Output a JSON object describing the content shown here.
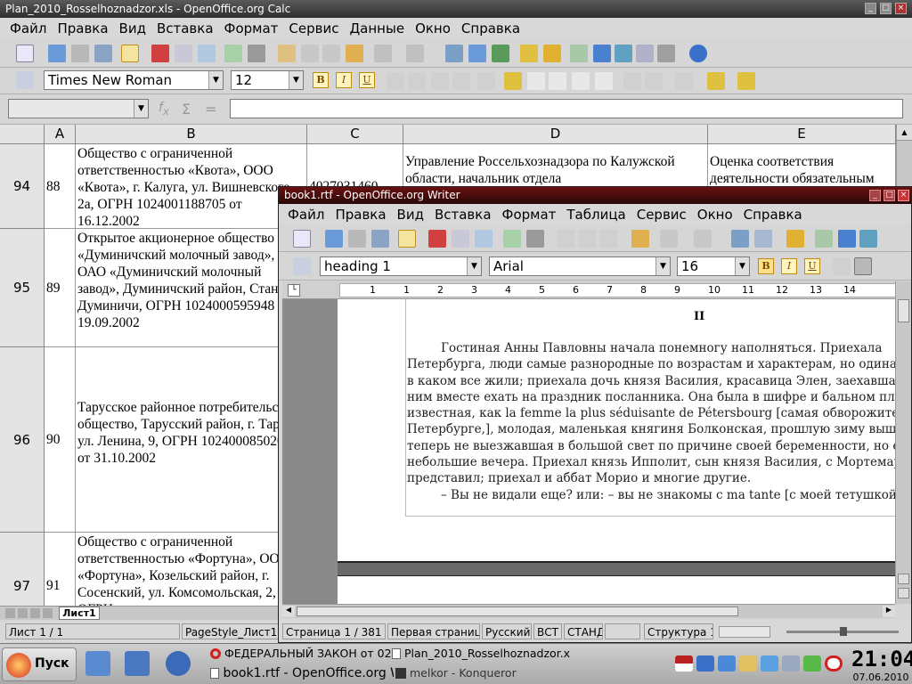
{
  "calc": {
    "title": "Plan_2010_Rosselhoznadzor.xls - OpenOffice.org Calc",
    "menu": [
      "Файл",
      "Правка",
      "Вид",
      "Вставка",
      "Формат",
      "Сервис",
      "Данные",
      "Окно",
      "Справка"
    ],
    "font_name": "Times New Roman",
    "font_size": "12",
    "columns": [
      "A",
      "B",
      "C",
      "D",
      "E"
    ],
    "rows": [
      {
        "num": "94",
        "a": "88",
        "b": "Общество с ограниченной ответственностью «Квота», ООО «Квота», г. Калуга, ул. Вишневского, 2а, ОГРН 1024001188705 от 16.12.2002",
        "c": "4027031460",
        "d": "Управление Россельхознадзора по Калужской области, начальник отдела",
        "e": "Оценка соответствия деятельности обязательным"
      },
      {
        "num": "95",
        "a": "89",
        "b": "Открытое акционерное общество «Думиничский молочный завод», ОАО «Думиничский молочный завод», Думиничский район, Станция Думиничи, ОГРН 1024000595948 от 19.09.2002"
      },
      {
        "num": "96",
        "a": "90",
        "b": "Тарусское районное потребительское общество, Тарусский район, г. Таруса, ул. Ленина, 9, ОГРН 1024000850200 от 31.10.2002"
      },
      {
        "num": "97",
        "a": "91",
        "b": "Общество с ограниченной ответственностью «Фортуна», ООО «Фортуна», Козельский район, г. Сосенский, ул. Комсомольская, 2, ОГРН"
      }
    ],
    "sheet_tab": "Лист1",
    "status_sheet": "Лист 1 / 1",
    "status_style": "PageStyle_Лист1"
  },
  "writer": {
    "title": "book1.rtf - OpenOffice.org Writer",
    "menu": [
      "Файл",
      "Правка",
      "Вид",
      "Вставка",
      "Формат",
      "Таблица",
      "Сервис",
      "Окно",
      "Справка"
    ],
    "para_style": "heading 1",
    "font_name": "Arial",
    "font_size": "16",
    "ruler_numbers": [
      "1",
      "1",
      "2",
      "3",
      "4",
      "5",
      "6",
      "7",
      "8",
      "9",
      "10",
      "11",
      "12",
      "13",
      "14"
    ],
    "heading": "II",
    "lines": [
      "Гостиная Анны Павловны начала понемногу наполняться. Приехала",
      "Петербурга, люди самые разнородные по возрастам и характерам, но одинаков",
      "в каком все жили; приехала дочь князя Василия, красавица Элен, заехавшая за",
      "ним вместе ехать на праздник посланника. Она была в шифре и бальном пла",
      "известная, как la femme la plus séduisante de Pétersbourg [самая обворожител",
      "Петербурге,], молодая, маленькая княгиня Болконская, прошлую зиму выш",
      "теперь не выезжавшая в большой свет по причине своей беременности, но е",
      "небольшие вечера. Приехал князь Ипполит, сын князя Василия, с Мортемар",
      "представил; приехал и аббат Морио и многие другие.",
      "– Вы не видали еще? или: – вы не знакомы с ma tante [с моей тетушкой]?"
    ],
    "status": {
      "page": "Страница  1 / 381",
      "page_style": "Первая страница",
      "language": "Русский",
      "insert": "ВСТ",
      "selection": "СТАНД",
      "structure": "Структура 1"
    }
  },
  "taskbar": {
    "start": "Пуск",
    "tasks": [
      "ФЕДЕРАЛЬНЫЙ ЗАКОН от 02.0",
      "Plan_2010_Rosselhoznadzor.xls",
      "book1.rtf - OpenOffice.org W",
      "melkor - Konqueror"
    ],
    "time": "21:04",
    "date": "07.06.2010"
  },
  "colors": {
    "calc_title": "#3a3a3a",
    "writer_title": "#4a0c0c",
    "desktop": "#4a4a4a"
  }
}
